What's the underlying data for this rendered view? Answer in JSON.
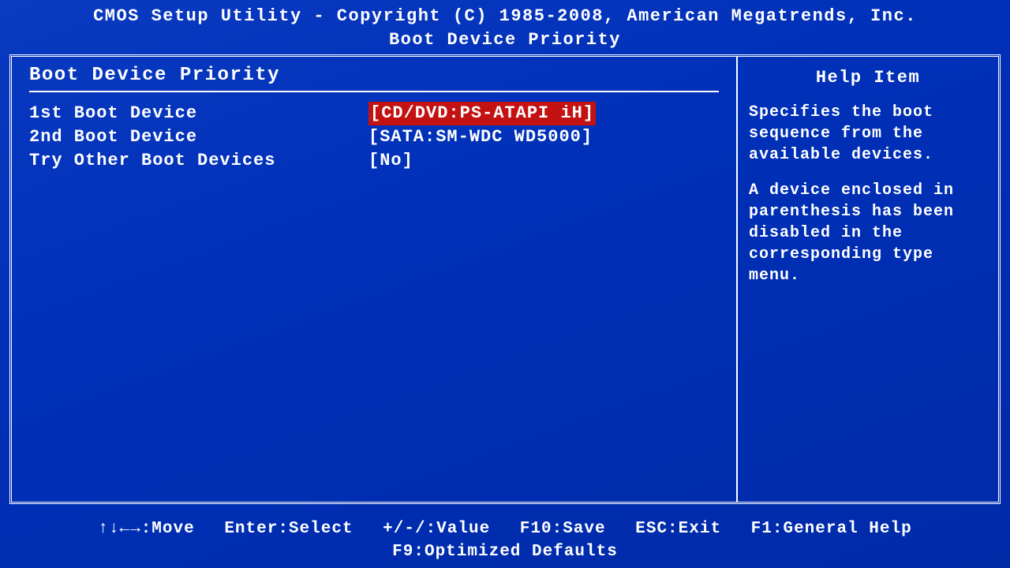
{
  "header": {
    "title": "CMOS Setup Utility - Copyright (C) 1985-2008, American Megatrends, Inc.",
    "subtitle": "Boot Device Priority"
  },
  "section": {
    "title": "Boot Device Priority"
  },
  "options": [
    {
      "label": "1st Boot Device",
      "value": "CD/DVD:PS-ATAPI iH",
      "selected": true
    },
    {
      "label": "2nd Boot Device",
      "value": "SATA:SM-WDC WD5000",
      "selected": false
    },
    {
      "label": "Try Other Boot Devices",
      "value": "No",
      "selected": false
    }
  ],
  "help": {
    "title": "Help Item",
    "para1": "Specifies the boot sequence from the available devices.",
    "para2": "A device enclosed in parenthesis has been disabled in the corresponding type menu."
  },
  "footer": {
    "move": "↑↓←→:Move",
    "select": "Enter:Select",
    "value": "+/-/:Value",
    "save": "F10:Save",
    "exit": "ESC:Exit",
    "help": "F1:General Help",
    "defaults": "F9:Optimized Defaults"
  }
}
